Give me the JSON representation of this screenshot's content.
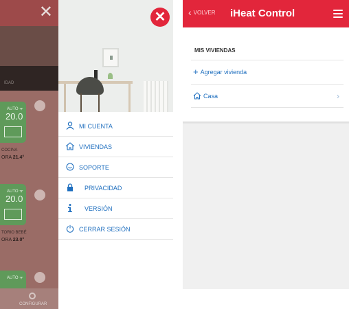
{
  "left_phone": {
    "background": {
      "close_symbol": "✕",
      "band_label": "IDAD",
      "zones": [
        {
          "mode": "AUTO ᯤ",
          "setpoint": "20.0",
          "name": "COCINA",
          "now_label": "ORA",
          "now_value": "21.4°"
        },
        {
          "mode": "AUTO ᯤ",
          "setpoint": "20.0",
          "name": "TORIO BEBÉ",
          "now_label": "ORA",
          "now_value": "23.0°"
        },
        {
          "mode": "AUTO ᯤ",
          "setpoint": "",
          "name": "",
          "now_label": "",
          "now_value": ""
        }
      ],
      "config_label": "CONFIGURAR"
    },
    "drawer": {
      "close_symbol": "✕",
      "menu": [
        {
          "id": "mi-cuenta",
          "label": "MI CUENTA",
          "icon": "user-icon"
        },
        {
          "id": "viviendas",
          "label": "VIVIENDAS",
          "icon": "house-icon"
        },
        {
          "id": "soporte",
          "label": "SOPORTE",
          "icon": "support-icon"
        },
        {
          "id": "privacidad",
          "label": "PRIVACIDAD",
          "icon": "lock-icon"
        },
        {
          "id": "version",
          "label": "VERSIÓN",
          "icon": "info-icon"
        },
        {
          "id": "cerrar-sesion",
          "label": "CERRAR SESIÓN",
          "icon": "power-icon"
        }
      ]
    }
  },
  "right_phone": {
    "header": {
      "back_label": "VOLVER",
      "title": "iHeat Control"
    },
    "section_title": "MIS VIVIENDAS",
    "add_label": "Agregar vivienda",
    "homes": [
      {
        "name": "Casa"
      }
    ]
  },
  "colors": {
    "brand_red": "#e2263b",
    "link_blue": "#1f6fbf"
  }
}
